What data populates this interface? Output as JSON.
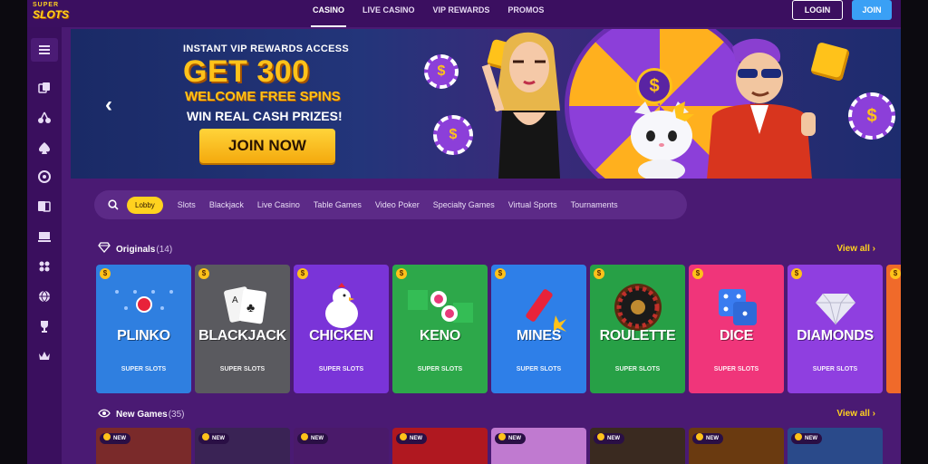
{
  "logo": {
    "line1": "SUPER",
    "line2": "SLOTS"
  },
  "nav": {
    "items": [
      {
        "label": "CASINO",
        "active": true
      },
      {
        "label": "LIVE CASINO",
        "active": false
      },
      {
        "label": "VIP REWARDS",
        "active": false
      },
      {
        "label": "PROMOS",
        "active": false
      }
    ],
    "login": "LOGIN",
    "join": "JOIN"
  },
  "sidebar": {
    "icons": [
      "menu-icon",
      "cards-icon",
      "cherry-icon",
      "spade-icon",
      "poker-chip-icon",
      "blackjack-icon",
      "monitor-icon",
      "grid-icon",
      "ball-icon",
      "trophy-icon",
      "crown-icon"
    ]
  },
  "banner": {
    "line1": "INSTANT VIP REWARDS ACCESS",
    "line2": "GET 300",
    "line3": "WELCOME FREE SPINS",
    "line4": "WIN REAL CASH PRIZES!",
    "cta": "JOIN NOW"
  },
  "filters": {
    "active": "Lobby",
    "items": [
      "Slots",
      "Blackjack",
      "Live Casino",
      "Table Games",
      "Video Poker",
      "Specialty Games",
      "Virtual Sports",
      "Tournaments"
    ]
  },
  "originals": {
    "title": "Originals",
    "count": "(14)",
    "view_all": "View all",
    "cards": [
      {
        "name": "PLINKO",
        "color": "#2f7fe0"
      },
      {
        "name": "BLACKJACK",
        "color": "#5a5a5f"
      },
      {
        "name": "CHICKEN",
        "color": "#7a34d8"
      },
      {
        "name": "KENO",
        "color": "#2da84a"
      },
      {
        "name": "MINES",
        "color": "#2e7fe8"
      },
      {
        "name": "ROULETTE",
        "color": "#27a046"
      },
      {
        "name": "DICE",
        "color": "#f0357a"
      },
      {
        "name": "DIAMONDS",
        "color": "#8f3fe0"
      }
    ],
    "brand": "SUPER SLOTS"
  },
  "new_games": {
    "title": "New Games",
    "count": "(35)",
    "view_all": "View all",
    "badge": "NEW",
    "colors": [
      "#7a2a2a",
      "#3a2355",
      "#4a1a6a",
      "#b01820",
      "#c07ad0",
      "#3a2a20",
      "#6a3a10",
      "#2a4a8a"
    ]
  }
}
